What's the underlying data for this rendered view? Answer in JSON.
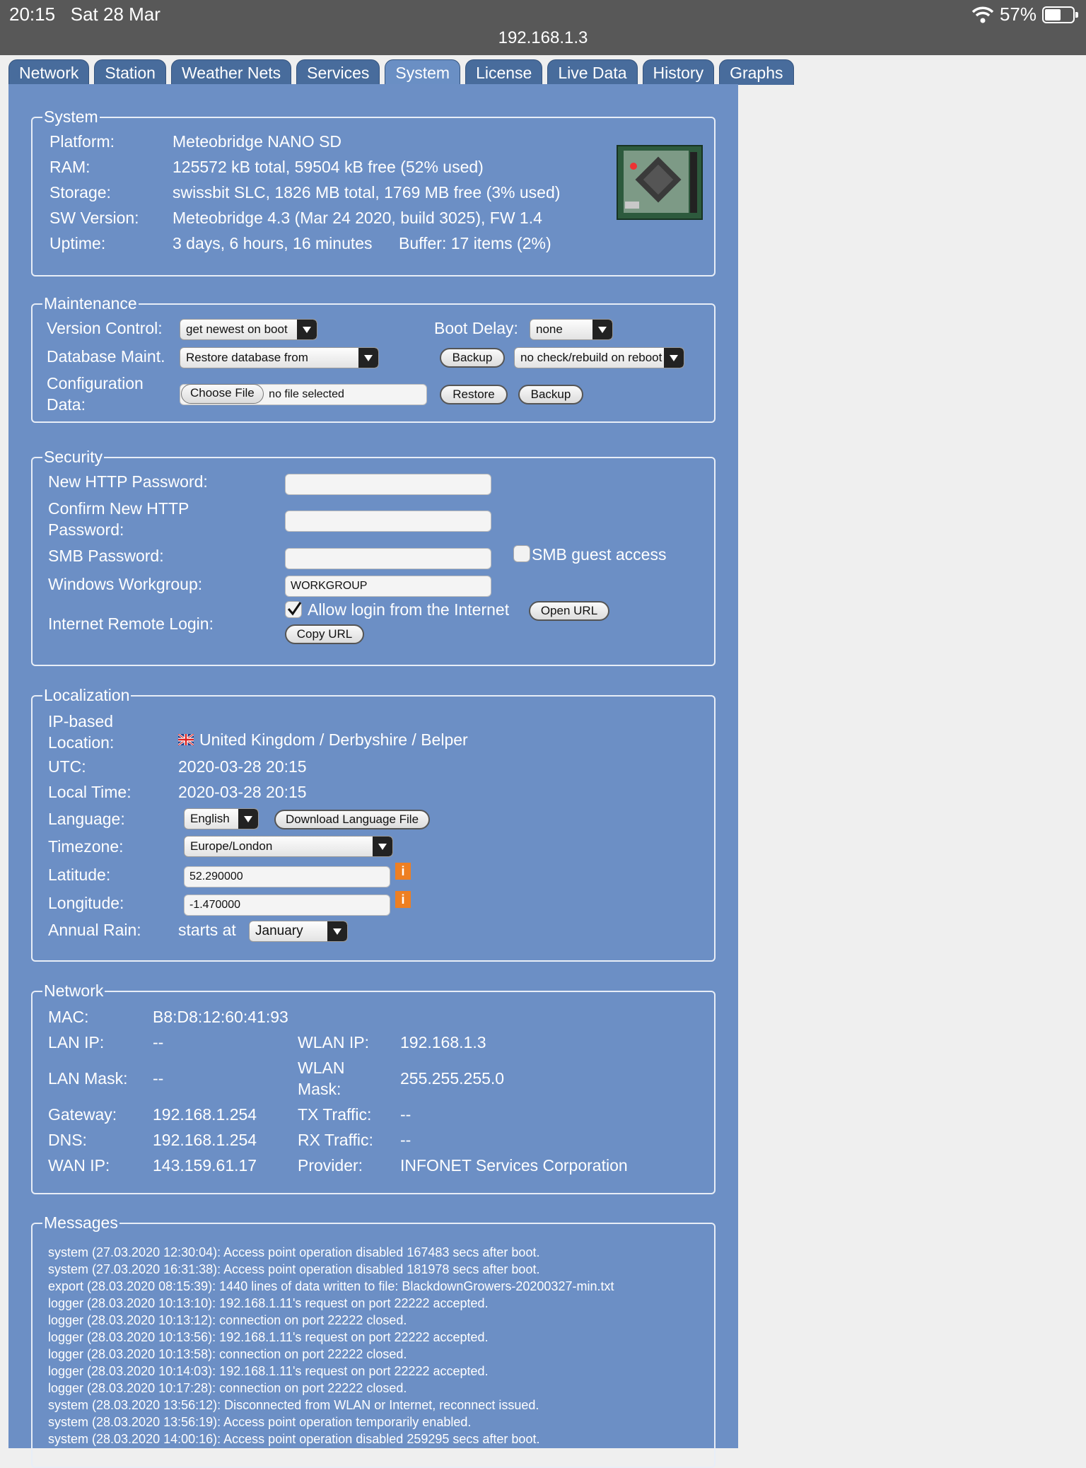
{
  "status_bar": {
    "time": "20:15",
    "date": "Sat 28 Mar",
    "battery": "57%",
    "battery_level": 0.57
  },
  "url": "192.168.1.3",
  "tabs": [
    {
      "label": "Network"
    },
    {
      "label": "Station"
    },
    {
      "label": "Weather Nets"
    },
    {
      "label": "Services"
    },
    {
      "label": "System",
      "active": true
    },
    {
      "label": "License"
    },
    {
      "label": "Live Data"
    },
    {
      "label": "History"
    },
    {
      "label": "Graphs"
    }
  ],
  "system": {
    "legend": "System",
    "platform_label": "Platform:",
    "platform": "Meteobridge NANO SD",
    "ram_label": "RAM:",
    "ram": "125572 kB total, 59504 kB free (52% used)",
    "storage_label": "Storage:",
    "storage": "swissbit SLC, 1826 MB total, 1769 MB free (3% used)",
    "sw_label": "SW Version:",
    "sw": "Meteobridge 4.3 (Mar 24 2020, build 3025), FW 1.4",
    "uptime_label": "Uptime:",
    "uptime": "3 days, 6 hours, 16 minutes",
    "buffer": "Buffer: 17 items (2%)"
  },
  "maintenance": {
    "legend": "Maintenance",
    "version_label": "Version Control:",
    "version_value": "get newest on boot",
    "boot_delay_label": "Boot Delay:",
    "boot_delay_value": "none",
    "db_label": "Database Maint.",
    "db_value": "Restore database from",
    "db_backup": "Backup",
    "db_check_value": "no check/rebuild on reboot",
    "config_label": "Configuration Data:",
    "choose_file": "Choose File",
    "no_file": "no file selected",
    "restore": "Restore",
    "backup": "Backup"
  },
  "security": {
    "legend": "Security",
    "new_pw_label": "New HTTP Password:",
    "confirm_pw_label": "Confirm New HTTP Password:",
    "smb_pw_label": "SMB Password:",
    "smb_guest_label": "SMB guest access",
    "smb_guest_checked": false,
    "workgroup_label": "Windows Workgroup:",
    "workgroup_value": "WORKGROUP",
    "remote_label": "Internet Remote Login:",
    "allow_label": "Allow login from the Internet",
    "allow_checked": true,
    "open_url": "Open URL",
    "copy_url": "Copy URL"
  },
  "localization": {
    "legend": "Localization",
    "ip_loc_label": "IP-based Location:",
    "ip_loc": "United Kingdom / Derbyshire / Belper",
    "utc_label": "UTC:",
    "utc": "2020-03-28 20:15",
    "local_label": "Local Time:",
    "local": "2020-03-28 20:15",
    "lang_label": "Language:",
    "lang_value": "English",
    "download_lang": "Download Language File",
    "tz_label": "Timezone:",
    "tz_value": "Europe/London",
    "lat_label": "Latitude:",
    "lat_value": "52.290000",
    "lon_label": "Longitude:",
    "lon_value": "-1.470000",
    "rain_label": "Annual Rain:",
    "rain_starts": "starts at",
    "rain_month": "January",
    "info": "i"
  },
  "network": {
    "legend": "Network",
    "mac_label": "MAC:",
    "mac": "B8:D8:12:60:41:93",
    "lan_ip_label": "LAN IP:",
    "lan_ip": "--",
    "wlan_ip_label": "WLAN IP:",
    "wlan_ip": "192.168.1.3",
    "lan_mask_label": "LAN Mask:",
    "lan_mask": "--",
    "wlan_mask_label": "WLAN Mask:",
    "wlan_mask": "255.255.255.0",
    "gateway_label": "Gateway:",
    "gateway": "192.168.1.254",
    "tx_label": "TX Traffic:",
    "tx": "--",
    "dns_label": "DNS:",
    "dns": "192.168.1.254",
    "rx_label": "RX Traffic:",
    "rx": "--",
    "wan_label": "WAN IP:",
    "wan": "143.159.61.17",
    "provider_label": "Provider:",
    "provider": "INFONET Services Corporation"
  },
  "messages": {
    "legend": "Messages",
    "lines": [
      "system (27.03.2020 12:30:04): Access point operation disabled 167483 secs after boot.",
      "system (27.03.2020 16:31:38): Access point operation disabled 181978 secs after boot.",
      "export (28.03.2020 08:15:39): 1440 lines of data written to file: BlackdownGrowers-20200327-min.txt",
      "logger (28.03.2020 10:13:10): 192.168.1.11's request on port 22222 accepted.",
      "logger (28.03.2020 10:13:12): connection on port 22222 closed.",
      "logger (28.03.2020 10:13:56): 192.168.1.11's request on port 22222 accepted.",
      "logger (28.03.2020 10:13:58): connection on port 22222 closed.",
      "logger (28.03.2020 10:14:03): 192.168.1.11's request on port 22222 accepted.",
      "logger (28.03.2020 10:17:28): connection on port 22222 closed.",
      "system (28.03.2020 13:56:12): Disconnected from WLAN or Internet, reconnect issued.",
      "system (28.03.2020 13:56:19): Access point operation temporarily enabled.",
      "system (28.03.2020 14:00:16): Access point operation disabled 259295 secs after boot."
    ]
  },
  "colors": {
    "panel": "#6c8fc5",
    "tab": "#486c9c",
    "info": "#ee7f22"
  }
}
